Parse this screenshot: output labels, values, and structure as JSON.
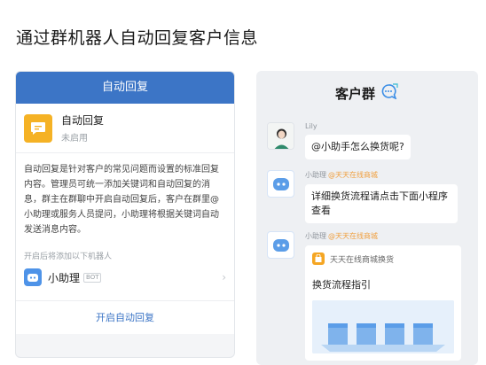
{
  "page": {
    "title": "通过群机器人自动回复客户信息"
  },
  "left": {
    "header": "自动回复",
    "card": {
      "title": "自动回复",
      "status": "未启用"
    },
    "description": "自动回复是针对客户的常见问题而设置的标准回复内容。管理员可统一添加关键词和自动回复的消息，群主在群聊中开启自动回复后，客户在群里@小助理或服务人员提问，小助理将根据关键词自动发送消息内容。",
    "added_label": "开启后将添加以下机器人",
    "assistant": {
      "name": "小助理",
      "tag": "BOT"
    },
    "enable_link": "开启自动回复"
  },
  "right": {
    "title": "客户群",
    "messages": [
      {
        "sender": "Lily",
        "text": "@小助手怎么换货呢?"
      },
      {
        "sender": "小助理",
        "sender_tag": "@天天在线商城",
        "text": "详细换货流程请点击下面小程序查看"
      },
      {
        "sender": "小助理",
        "sender_tag": "@天天在线商城",
        "card": {
          "shop": "天天在线商城换货",
          "title": "换货流程指引"
        }
      }
    ]
  },
  "colors": {
    "accent": "#3c75c6",
    "yellow": "#f5b225",
    "tag_orange": "#f0a040"
  }
}
